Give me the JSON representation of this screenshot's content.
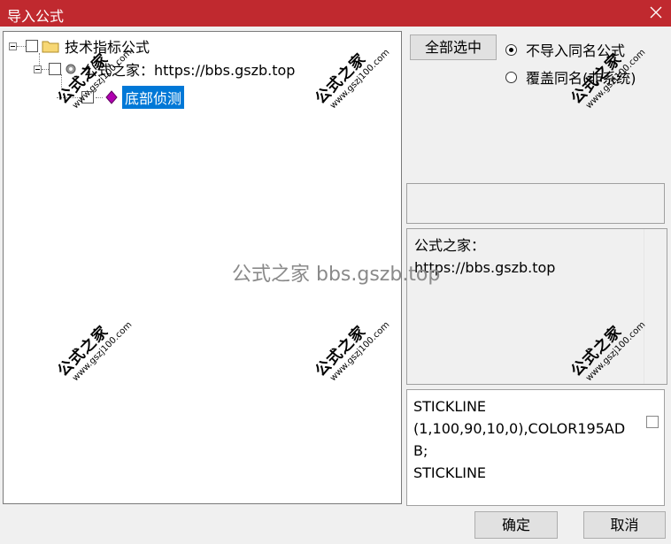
{
  "window": {
    "title": "导入公式"
  },
  "tree": {
    "root_label": "技术指标公式",
    "group_label": "公式之家：https://bbs.gszb.top",
    "item_label": "底部侦测"
  },
  "options": {
    "select_all_label": "全部选中",
    "radio_skip_label": "不导入同名公式",
    "radio_overwrite_label": "覆盖同名(非系统)"
  },
  "description": {
    "line1": "公式之家：",
    "line2": "https://bbs.gszb.top"
  },
  "code": {
    "line1": "STICKLINE",
    "line2": "(1,100,90,10,0),COLOR195AD",
    "line3": "B;",
    "line4": "STICKLINE"
  },
  "footer": {
    "ok_label": "确定",
    "cancel_label": "取消"
  },
  "watermarks": {
    "center_text": "公式之家 bbs.gszb.top",
    "stamp_text": "公式之家",
    "stamp_url": "www.gszj100.com"
  },
  "colors": {
    "title_bar": "#c0292f",
    "selection": "#0078d7",
    "folder": "#f7d774",
    "item_icon": "#b000b0"
  }
}
